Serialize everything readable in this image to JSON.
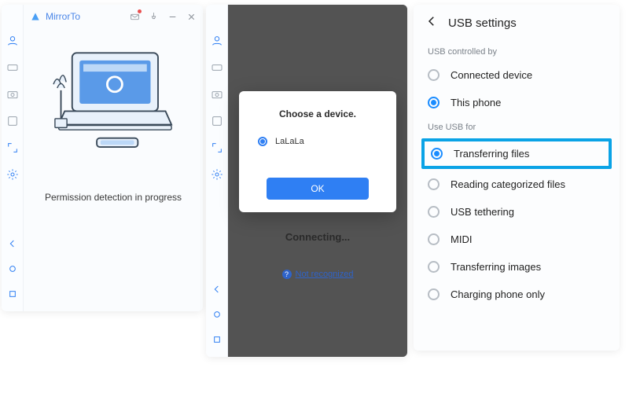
{
  "app": {
    "title": "MirrorTo"
  },
  "panel1": {
    "status": "Permission detection in progress"
  },
  "panel2": {
    "modal_title": "Choose a device.",
    "device_option": "LaLaLa",
    "ok_label": "OK",
    "connecting": "Connecting...",
    "not_recognized": "Not recognized"
  },
  "panel3": {
    "title": "USB settings",
    "controlled_by_label": "USB controlled by",
    "controlled_by": [
      {
        "label": "Connected device",
        "selected": false
      },
      {
        "label": "This phone",
        "selected": true
      }
    ],
    "use_for_label": "Use USB for",
    "use_for": [
      {
        "label": "Transferring files",
        "selected": true,
        "highlight": true
      },
      {
        "label": "Reading categorized files",
        "selected": false
      },
      {
        "label": "USB tethering",
        "selected": false
      },
      {
        "label": "MIDI",
        "selected": false
      },
      {
        "label": "Transferring images",
        "selected": false
      },
      {
        "label": "Charging phone only",
        "selected": false
      }
    ]
  }
}
